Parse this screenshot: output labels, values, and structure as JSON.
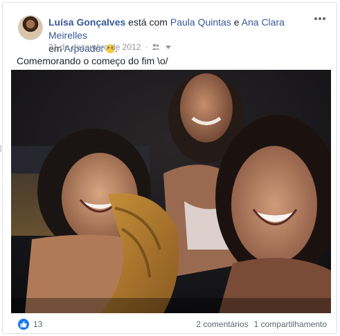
{
  "post": {
    "author": "Luísa Gonçalves",
    "with_text": "está com",
    "tag1": "Paula Quintas",
    "and_text": "e",
    "tag2": "Ana Clara Meirelles",
    "in_text": "em",
    "place": "Arpoador",
    "date": "21 de dezembro de 2012",
    "dot": "·",
    "status_text": "Comemorando o começo do fim \\o/",
    "emoji": "smile-emoji",
    "audience_icon": "friends-icon"
  },
  "reactions": {
    "like_count": "13",
    "comments": "2 comentários",
    "shares": "1 compartilhamento",
    "like_color": "#1877f2"
  },
  "colors": {
    "link": "#385898",
    "meta": "#90949c"
  }
}
